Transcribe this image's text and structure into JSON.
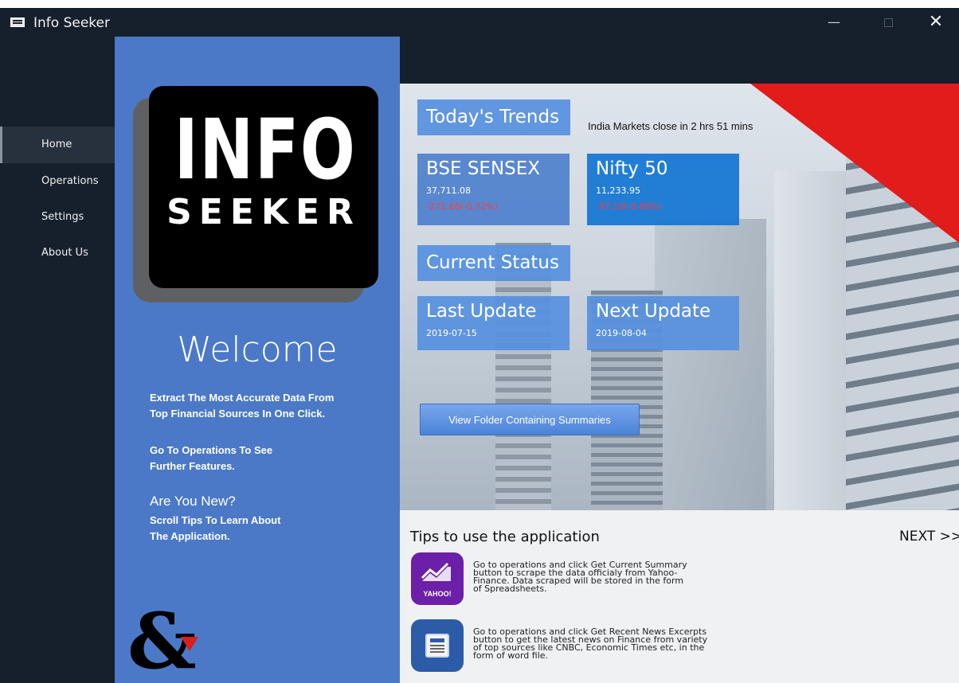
{
  "window": {
    "title": "Info Seeker"
  },
  "titlebar_buttons": {
    "minimize": "—",
    "close": "✕"
  },
  "sidebar": {
    "items": [
      {
        "label": "Home",
        "active": true
      },
      {
        "label": "Operations",
        "active": false
      },
      {
        "label": "Settings",
        "active": false
      },
      {
        "label": "About Us",
        "active": false
      }
    ]
  },
  "logo": {
    "line1": "INFO",
    "line2": "SEEKER"
  },
  "left_panel": {
    "welcome": "Welcome",
    "tagline_1": "Extract The Most Accurate Data From",
    "tagline_2": "Top Financial Sources In One Click.",
    "ops_1": "Go To Operations To See",
    "ops_2": "Further Features.",
    "new_heading": "Are You New?",
    "new_1": "Scroll Tips To Learn About",
    "new_2": "The Application.",
    "brand_glyph": "&"
  },
  "trends": {
    "heading": "Today's Trends",
    "market_note": "India Markets close in 2 hrs 51 mins",
    "cards": [
      {
        "title": "BSE SENSEX",
        "value": "37,711.08",
        "change": "-271.66(-0.72%)"
      },
      {
        "title": "Nifty 50",
        "value": "11,233.95",
        "change": "-97.10(-0.86%)"
      }
    ]
  },
  "status": {
    "heading": "Current Status",
    "cards": [
      {
        "title": "Last Update",
        "value": "2019-07-15"
      },
      {
        "title": "Next Update",
        "value": "2019-08-04"
      }
    ],
    "view_button": "View Folder Containing Summaries"
  },
  "tips": {
    "title": "Tips to use the application",
    "next": "NEXT >>",
    "items": [
      {
        "icon": "yahoo-finance-icon",
        "badge": "YAHOO!",
        "lines": [
          "Go to operations and click Get Current Summary",
          "button to scrape the data officialy from Yahoo-",
          "Finance. Data scraped will be stored in the form",
          "of Spreadsheets."
        ]
      },
      {
        "icon": "news-icon",
        "lines": [
          "Go to operations and click Get Recent News Excerpts",
          "button to get the latest news on Finance from variety",
          "of top sources like CNBC, Economic Times etc, in the",
          "form of word file."
        ]
      }
    ]
  },
  "colors": {
    "sidebar": "#16202c",
    "panel": "#4b79c7",
    "tile": "#5690de",
    "accent_red": "#e21b1b",
    "negative": "#ff3b3b"
  }
}
